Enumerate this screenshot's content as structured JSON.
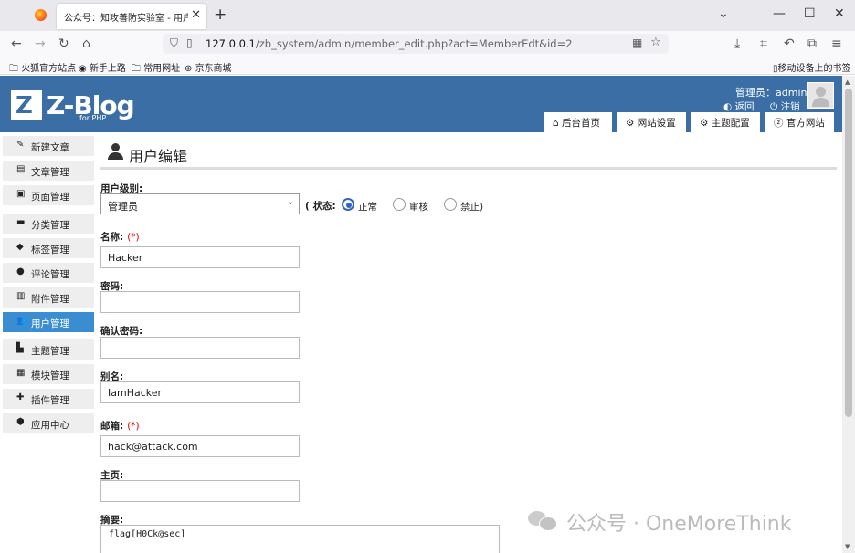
{
  "browser": {
    "tab_title": "公众号：知攻善防实验室 - 用户编辑",
    "url_host": "127.0.0.1",
    "url_path": "/zb_system/admin/member_edit.php?act=MemberEdt&id=2",
    "bookmarks": [
      "火狐官方站点",
      "新手上路",
      "常用网址",
      "京东商城"
    ],
    "mobile_bookmarks": "移动设备上的书签"
  },
  "header": {
    "logo_main": "Z-Blog",
    "logo_z": "Z",
    "logo_sub": "for PHP",
    "admin_label": "管理员：admin",
    "back_link": "返回",
    "logout_link": "注销",
    "tabs": [
      "后台首页",
      "网站设置",
      "主题配置",
      "官方网站"
    ]
  },
  "sidebar": {
    "items": [
      {
        "label": "新建文章",
        "icon": "edit-icon"
      },
      {
        "label": "文章管理",
        "icon": "article-icon"
      },
      {
        "label": "页面管理",
        "icon": "page-icon"
      },
      {
        "label": "分类管理",
        "icon": "folder-icon"
      },
      {
        "label": "标签管理",
        "icon": "tag-icon"
      },
      {
        "label": "评论管理",
        "icon": "comment-icon"
      },
      {
        "label": "附件管理",
        "icon": "attachment-icon"
      },
      {
        "label": "用户管理",
        "icon": "users-icon"
      },
      {
        "label": "主题管理",
        "icon": "theme-icon"
      },
      {
        "label": "模块管理",
        "icon": "module-icon"
      },
      {
        "label": "插件管理",
        "icon": "plugin-icon"
      },
      {
        "label": "应用中心",
        "icon": "app-center-icon"
      }
    ],
    "active_index": 7
  },
  "form": {
    "title": "用户编辑",
    "level_label": "用户级别:",
    "level_value": "管理员",
    "status_label": "( 状态:",
    "status_options": [
      "正常",
      "审核",
      "禁止)"
    ],
    "status_selected": 0,
    "name_label": "名称:",
    "name_value": "Hacker",
    "password_label": "密码:",
    "password_value": "",
    "confirm_label": "确认密码:",
    "confirm_value": "",
    "alias_label": "别名:",
    "alias_value": "IamHacker",
    "email_label": "邮箱:",
    "email_value": "hack@attack.com",
    "homepage_label": "主页:",
    "homepage_value": "",
    "summary_label": "摘要:",
    "summary_value": "flag[H0Ck@sec]",
    "required_mark": "(*)"
  },
  "watermark": {
    "text": "公众号 · OneMoreThink"
  },
  "colors": {
    "header_bg": "#3a6ea5",
    "active_sidebar": "#3a8dd0",
    "required": "#dd0000"
  }
}
